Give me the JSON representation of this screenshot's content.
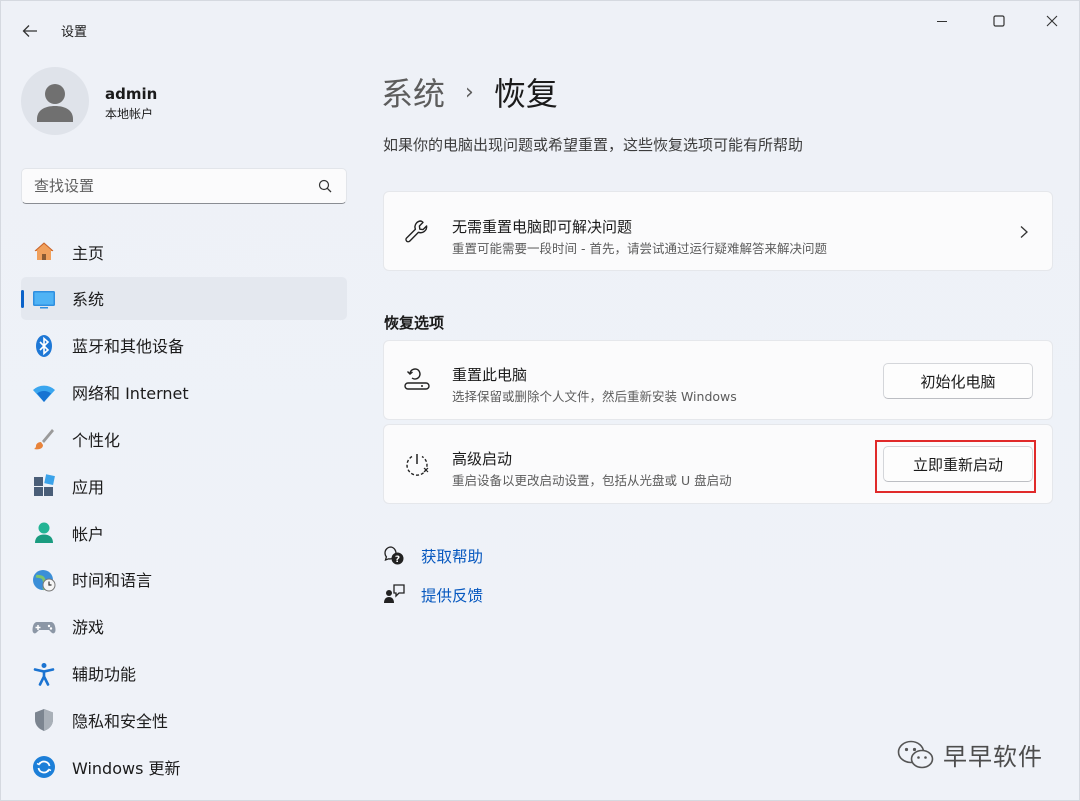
{
  "window": {
    "title": "设置"
  },
  "profile": {
    "name": "admin",
    "account_type": "本地帐户"
  },
  "search": {
    "placeholder": "查找设置"
  },
  "nav": {
    "items": [
      {
        "label": "主页",
        "icon": "home-icon"
      },
      {
        "label": "系统",
        "icon": "system-icon",
        "active": true
      },
      {
        "label": "蓝牙和其他设备",
        "icon": "bluetooth-icon"
      },
      {
        "label": "网络和 Internet",
        "icon": "wifi-icon"
      },
      {
        "label": "个性化",
        "icon": "brush-icon"
      },
      {
        "label": "应用",
        "icon": "apps-icon"
      },
      {
        "label": "帐户",
        "icon": "account-icon"
      },
      {
        "label": "时间和语言",
        "icon": "time-language-icon"
      },
      {
        "label": "游戏",
        "icon": "gamepad-icon"
      },
      {
        "label": "辅助功能",
        "icon": "accessibility-icon"
      },
      {
        "label": "隐私和安全性",
        "icon": "shield-icon"
      },
      {
        "label": "Windows 更新",
        "icon": "update-icon"
      }
    ]
  },
  "main": {
    "breadcrumb": {
      "parent": "系统",
      "separator": "›",
      "current": "恢复"
    },
    "description": "如果你的电脑出现问题或希望重置，这些恢复选项可能有所帮助",
    "troubleshoot": {
      "title": "无需重置电脑即可解决问题",
      "desc": "重置可能需要一段时间 - 首先，请尝试通过运行疑难解答来解决问题"
    },
    "section_title": "恢复选项",
    "reset": {
      "title": "重置此电脑",
      "desc": "选择保留或删除个人文件，然后重新安装 Windows",
      "button": "初始化电脑"
    },
    "advanced": {
      "title": "高级启动",
      "desc": "重启设备以更改启动设置，包括从光盘或 U 盘启动",
      "button": "立即重新启动"
    },
    "links": {
      "help": "获取帮助",
      "feedback": "提供反馈"
    }
  },
  "watermark": {
    "text": "早早软件"
  },
  "colors": {
    "accent": "#0a62c9",
    "link": "#0658bf",
    "highlight": "#e02a2a"
  }
}
